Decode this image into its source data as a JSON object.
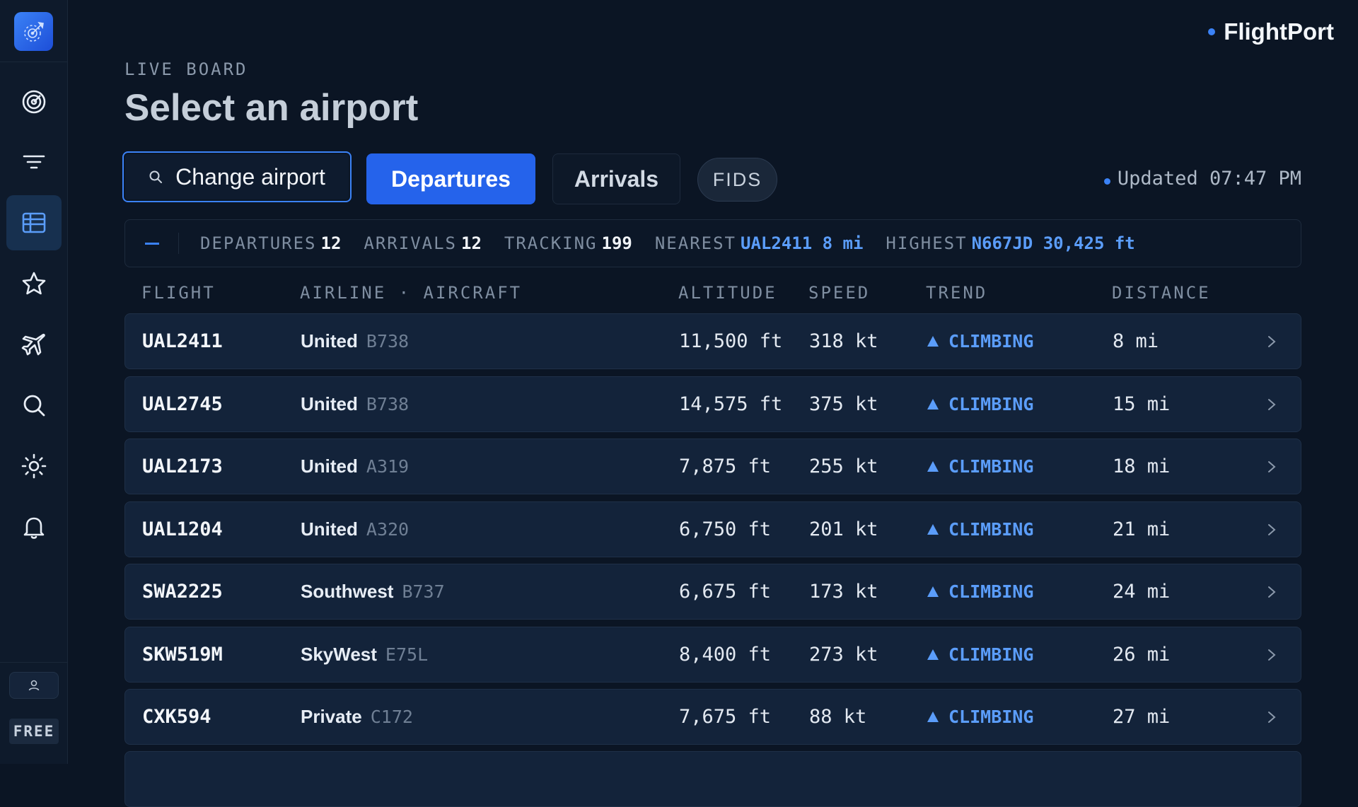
{
  "brand": {
    "name": "FlightPort"
  },
  "sidebar": {
    "items": [
      {
        "icon": "radar-icon",
        "active": false
      },
      {
        "icon": "filter-icon",
        "active": false
      },
      {
        "icon": "table-icon",
        "active": true
      },
      {
        "icon": "star-icon",
        "active": false
      },
      {
        "icon": "plane-icon",
        "active": false
      },
      {
        "icon": "search-icon",
        "active": false
      },
      {
        "icon": "sun-icon",
        "active": false
      },
      {
        "icon": "bell-icon",
        "active": false
      }
    ],
    "plan": "FREE"
  },
  "header": {
    "eyebrow": "LIVE BOARD",
    "title": "Select an airport"
  },
  "toolbar": {
    "change_airport": "Change airport",
    "departures": "Departures",
    "arrivals": "Arrivals",
    "fids": "FIDS",
    "updated": "Updated 07:47 PM"
  },
  "stats": {
    "departures_label": "DEPARTURES",
    "departures_value": "12",
    "arrivals_label": "ARRIVALS",
    "arrivals_value": "12",
    "tracking_label": "TRACKING",
    "tracking_value": "199",
    "nearest_label": "NEAREST",
    "nearest_value": "UAL2411 8 mi",
    "highest_label": "HIGHEST",
    "highest_value": "N667JD 30,425 ft"
  },
  "table": {
    "columns": [
      "FLIGHT",
      "AIRLINE · AIRCRAFT",
      "ALTITUDE",
      "SPEED",
      "TREND",
      "DISTANCE"
    ],
    "rows": [
      {
        "flight": "UAL2411",
        "airline": "United",
        "aircraft": "B738",
        "altitude": "11,500 ft",
        "speed": "318 kt",
        "trend": "CLIMBING",
        "distance": "8 mi"
      },
      {
        "flight": "UAL2745",
        "airline": "United",
        "aircraft": "B738",
        "altitude": "14,575 ft",
        "speed": "375 kt",
        "trend": "CLIMBING",
        "distance": "15 mi"
      },
      {
        "flight": "UAL2173",
        "airline": "United",
        "aircraft": "A319",
        "altitude": "7,875 ft",
        "speed": "255 kt",
        "trend": "CLIMBING",
        "distance": "18 mi"
      },
      {
        "flight": "UAL1204",
        "airline": "United",
        "aircraft": "A320",
        "altitude": "6,750 ft",
        "speed": "201 kt",
        "trend": "CLIMBING",
        "distance": "21 mi"
      },
      {
        "flight": "SWA2225",
        "airline": "Southwest",
        "aircraft": "B737",
        "altitude": "6,675 ft",
        "speed": "173 kt",
        "trend": "CLIMBING",
        "distance": "24 mi"
      },
      {
        "flight": "SKW519M",
        "airline": "SkyWest",
        "aircraft": "E75L",
        "altitude": "8,400 ft",
        "speed": "273 kt",
        "trend": "CLIMBING",
        "distance": "26 mi"
      },
      {
        "flight": "CXK594",
        "airline": "Private",
        "aircraft": "C172",
        "altitude": "7,675 ft",
        "speed": "88 kt",
        "trend": "CLIMBING",
        "distance": "27 mi"
      }
    ]
  },
  "colors": {
    "accent": "#2563eb",
    "accent_text": "#5b9dfa",
    "background": "#0b1524",
    "row": "#13233a"
  }
}
